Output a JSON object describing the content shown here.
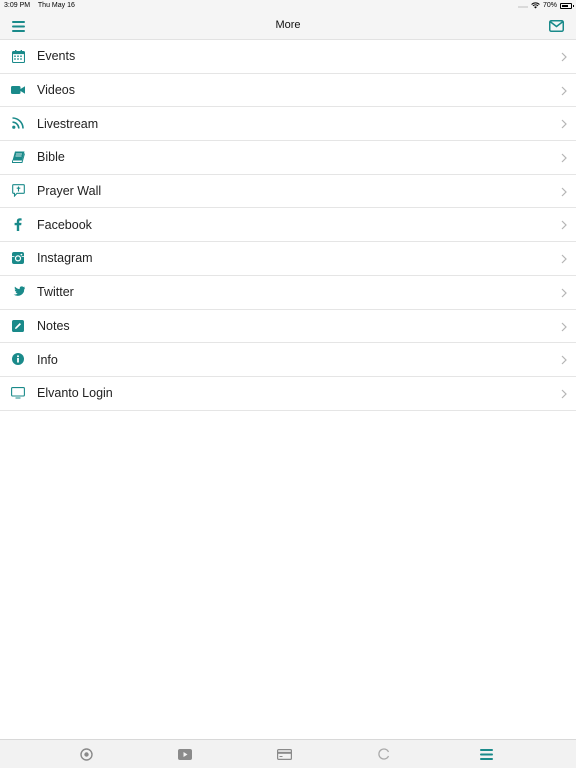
{
  "status_bar": {
    "time": "3:09 PM",
    "date": "Thu May 16",
    "battery": "70%",
    "battery_level": 0.7
  },
  "nav": {
    "title": "More",
    "left_icon": "hamburger-menu-icon",
    "right_icon": "envelope-icon"
  },
  "colors": {
    "accent": "#1a8a8a",
    "chevron": "#b5b5b5",
    "tab_inactive": "#8a8a8a"
  },
  "menu": {
    "items": [
      {
        "label": "Events",
        "icon": "calendar-icon"
      },
      {
        "label": "Videos",
        "icon": "video-camera-icon"
      },
      {
        "label": "Livestream",
        "icon": "rss-icon"
      },
      {
        "label": "Bible",
        "icon": "book-icon"
      },
      {
        "label": "Prayer Wall",
        "icon": "prayer-bubble-icon"
      },
      {
        "label": "Facebook",
        "icon": "facebook-icon"
      },
      {
        "label": "Instagram",
        "icon": "instagram-icon"
      },
      {
        "label": "Twitter",
        "icon": "twitter-icon"
      },
      {
        "label": "Notes",
        "icon": "pencil-square-icon"
      },
      {
        "label": "Info",
        "icon": "info-circle-icon"
      },
      {
        "label": "Elvanto Login",
        "icon": "desktop-monitor-icon"
      }
    ]
  },
  "tab_bar": {
    "tabs": [
      {
        "icon": "record-circle-icon"
      },
      {
        "icon": "play-video-icon"
      },
      {
        "icon": "card-icon"
      },
      {
        "icon": "spinner-icon"
      },
      {
        "icon": "hamburger-menu-icon",
        "active": true
      }
    ]
  }
}
